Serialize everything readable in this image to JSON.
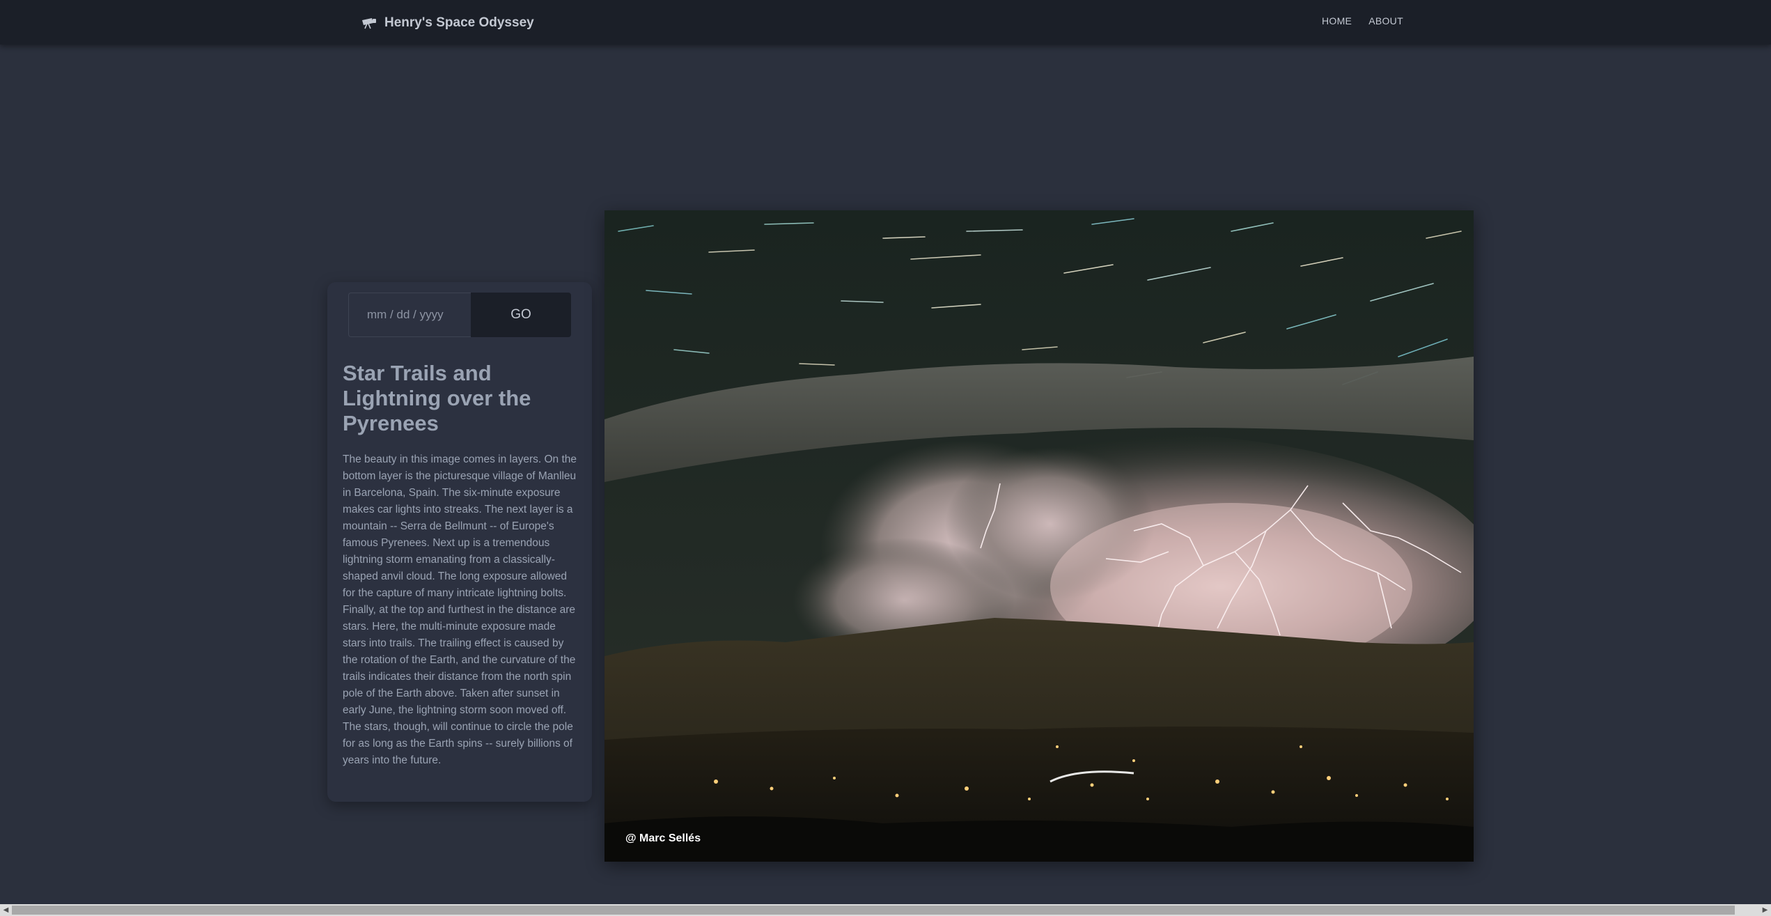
{
  "header": {
    "brand_icon": "telescope-icon",
    "brand_title": "Henry's Space Odyssey",
    "nav": [
      "HOME",
      "ABOUT"
    ]
  },
  "date_form": {
    "placeholder": "mm / dd / yyyy",
    "go_label": "GO"
  },
  "article": {
    "title": "Star Trails and Lightning over the Pyrenees",
    "description": "The beauty in this image comes in layers. On the bottom layer is the picturesque village of Manlleu in Barcelona, Spain. The six-minute exposure makes car lights into streaks. The next layer is a mountain -- Serra de Bellmunt -- of Europe's famous Pyrenees. Next up is a tremendous lightning storm emanating from a classically-shaped anvil cloud. The long exposure allowed for the capture of many intricate lightning bolts. Finally, at the top and furthest in the distance are stars. Here, the multi-minute exposure made stars into trails. The trailing effect is caused by the rotation of the Earth, and the curvature of the trails indicates their distance from the north spin pole of the Earth above. Taken after sunset in early June, the lightning storm soon moved off. The stars, though, will continue to circle the pole for as long as the Earth spins -- surely billions of years into the future.",
    "photo_credit": "@ Marc Sellés"
  },
  "scrollbar": {
    "left_arrow": "◀",
    "right_arrow": "▶"
  },
  "colors": {
    "page_bg": "#2b303d",
    "navbar_bg": "#1b1f28",
    "text": "#9aa3b3"
  }
}
